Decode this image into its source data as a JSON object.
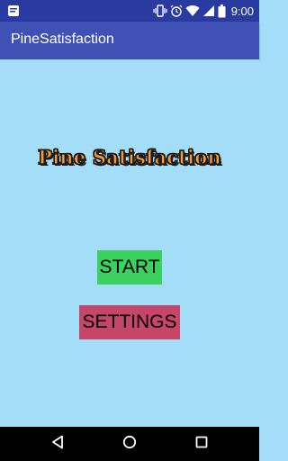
{
  "status_bar": {
    "time": "9:00",
    "icons": [
      "notification-icon",
      "vibrate-icon",
      "alarm-icon",
      "wifi-icon",
      "signal-icon",
      "battery-icon"
    ]
  },
  "app_bar": {
    "title": "PineSatisfaction"
  },
  "main": {
    "game_title": "Pine Satisfaction",
    "start_label": "START",
    "settings_label": "SETTINGS"
  },
  "nav_bar": {
    "icons": [
      "back-icon",
      "home-icon",
      "recents-icon"
    ]
  },
  "colors": {
    "status_bar": "#293aa0",
    "app_bar": "#3f51b5",
    "background": "#a3ddf7",
    "start_button": "#3ad15e",
    "settings_button": "#c54669",
    "title_fill": "#ff9a2a"
  }
}
